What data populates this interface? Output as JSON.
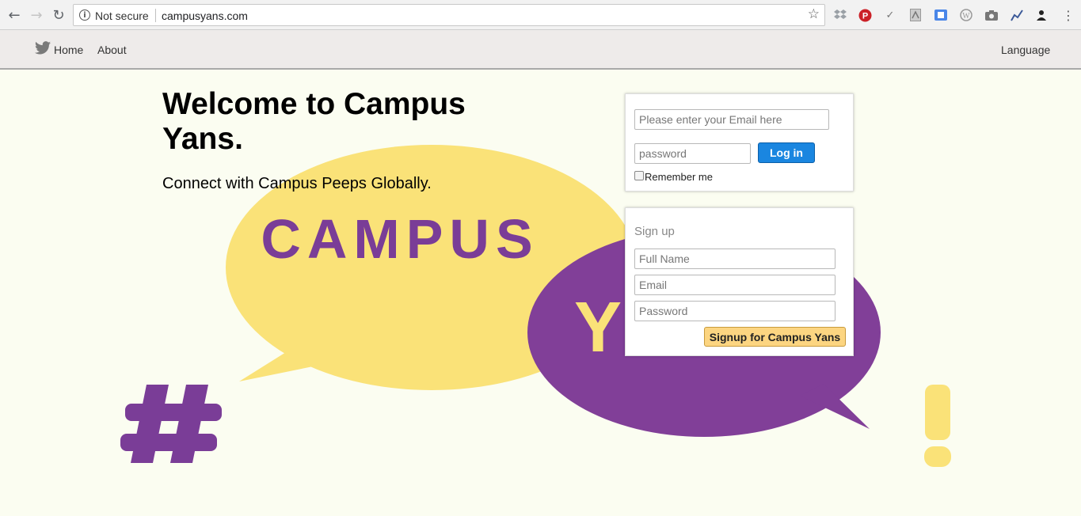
{
  "browser": {
    "back_icon": "arrow-left-icon",
    "forward_icon": "arrow-right-icon",
    "reload_icon": "reload-icon",
    "security_label": "Not secure",
    "url": "campusyans.com",
    "extensions": [
      "dropbox-icon",
      "pinterest-icon",
      "checkmark-icon",
      "pdf-icon",
      "translate-icon",
      "wordpress-icon",
      "camera-icon",
      "chart-icon",
      "profile-icon",
      "menu-icon"
    ]
  },
  "navbar": {
    "home_label": "Home",
    "about_label": "About",
    "language_label": "Language"
  },
  "hero": {
    "title": "Welcome to Campus Yans.",
    "subtitle": "Connect with Campus Peeps Globally.",
    "logo_word": "CAMPUS",
    "logo_letter": "Y"
  },
  "login": {
    "email_placeholder": "Please enter your Email here",
    "password_placeholder": "password",
    "button_label": "Log in",
    "remember_label": "Remember me"
  },
  "signup": {
    "title": "Sign up",
    "fullname_placeholder": "Full Name",
    "email_placeholder": "Email",
    "password_placeholder": "Password",
    "button_label": "Signup for Campus Yans"
  },
  "colors": {
    "page_bg": "#fbfdf1",
    "yellow_bubble": "#fae278",
    "purple_bubble": "#813f98",
    "login_button": "#1a86e0",
    "signup_button": "#fcd581"
  }
}
